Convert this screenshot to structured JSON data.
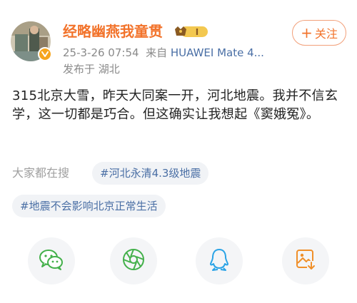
{
  "post": {
    "username": "经略幽燕我童贯",
    "level_badge": "I",
    "follow_label": "关注",
    "follow_plus": "+",
    "timestamp": "25-3-26 07:54",
    "source_prefix": "来自",
    "source_device": "HUAWEI Mate 4...",
    "location": "发布于 湖北",
    "text": "315北京大雪，昨天大同案一开，河北地震。我并不信玄学，这一切都是巧合。但这确实让我想起《窦娥冤》。"
  },
  "search": {
    "label": "大家都在搜",
    "tags": [
      "#河北永清4.3级地震",
      "#地震不会影响北京正常生活"
    ]
  },
  "share": {
    "icons": [
      "wechat-icon",
      "moments-icon",
      "qq-icon",
      "save-image-icon"
    ]
  },
  "colors": {
    "accent": "#f2732b",
    "link": "#4a6fa5",
    "meta": "#8a8a8a",
    "tag_bg": "#f1f3f6"
  }
}
